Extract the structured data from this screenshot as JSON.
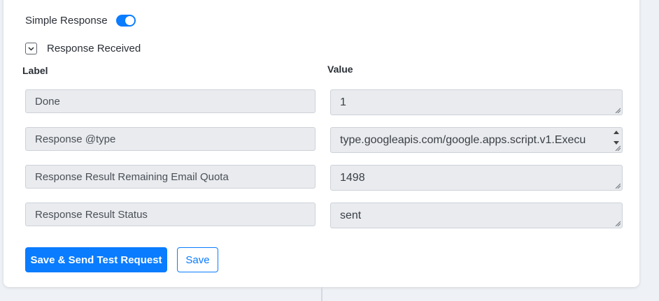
{
  "simple_response": {
    "label": "Simple Response",
    "enabled": true
  },
  "response_section": {
    "title": "Response Received",
    "expanded": true
  },
  "headers": {
    "label": "Label",
    "value": "Value"
  },
  "rows": [
    {
      "label": "Done",
      "value": "1"
    },
    {
      "label": "Response @type",
      "value": "type.googleapis.com/google.apps.script.v1.Execu"
    },
    {
      "label": "Response Result Remaining Email Quota",
      "value": "1498"
    },
    {
      "label": "Response Result Status",
      "value": "sent"
    }
  ],
  "buttons": {
    "save_and_test": "Save & Send Test Request",
    "save": "Save"
  },
  "colors": {
    "accent": "#0a7cff",
    "field_bg": "#e9ebee",
    "page_bg": "#eef1f5"
  }
}
